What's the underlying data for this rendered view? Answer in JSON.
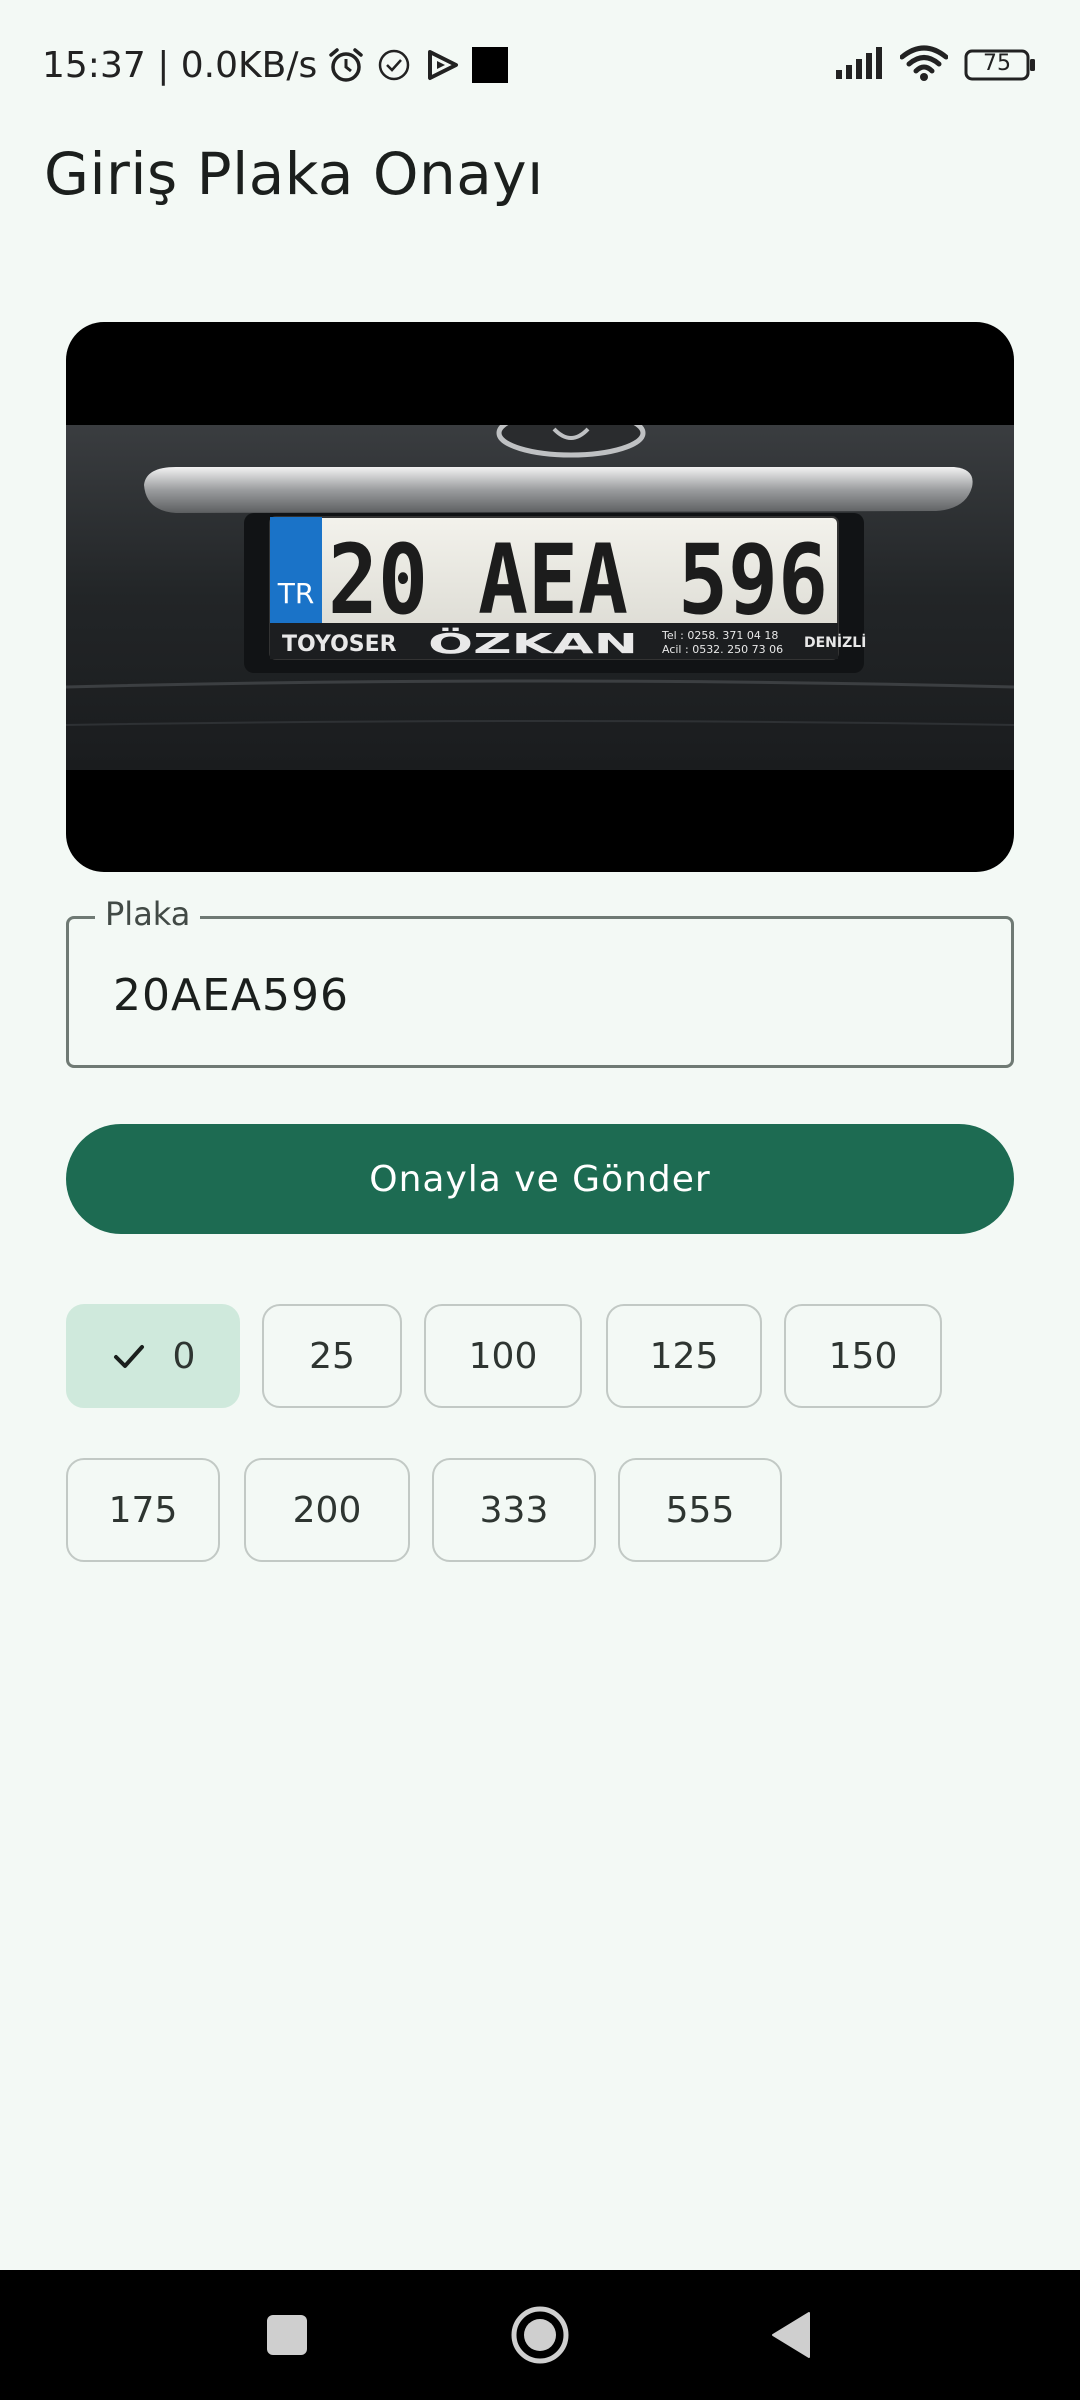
{
  "status_bar": {
    "time_speed": "15:37 | 0.0KB/s",
    "battery_level": "75",
    "icons": [
      "alarm-icon",
      "check-circle-icon",
      "play-icon",
      "square-icon",
      "signal-icon",
      "wifi-icon",
      "battery-icon"
    ]
  },
  "page": {
    "title": "Giriş Plaka Onayı"
  },
  "photo": {
    "plate_text": "20 AEA 596",
    "country_code": "TR",
    "frame_brand": "TOYOSER",
    "frame_dealer": "ÖZKAN",
    "frame_city": "DENİZLİ",
    "frame_tel_1": "Tel : 0258. 371 04 18",
    "frame_tel_2": "Acil : 0532. 250 73 06"
  },
  "plate_field": {
    "label": "Plaka",
    "value": "20AEA596"
  },
  "submit": {
    "label": "Onayla ve Gönder"
  },
  "chips": [
    {
      "label": "0",
      "selected": true
    },
    {
      "label": "25",
      "selected": false
    },
    {
      "label": "100",
      "selected": false
    },
    {
      "label": "125",
      "selected": false
    },
    {
      "label": "150",
      "selected": false
    },
    {
      "label": "175",
      "selected": false
    },
    {
      "label": "200",
      "selected": false
    },
    {
      "label": "333",
      "selected": false
    },
    {
      "label": "555",
      "selected": false
    }
  ],
  "colors": {
    "background": "#f3f9f5",
    "primary": "#1d6b52",
    "chip_selected": "#cfe9dc",
    "plate_blue": "#1a73c8"
  },
  "nav": {
    "icons": [
      "recents-square-icon",
      "home-circle-icon",
      "back-triangle-icon"
    ]
  }
}
